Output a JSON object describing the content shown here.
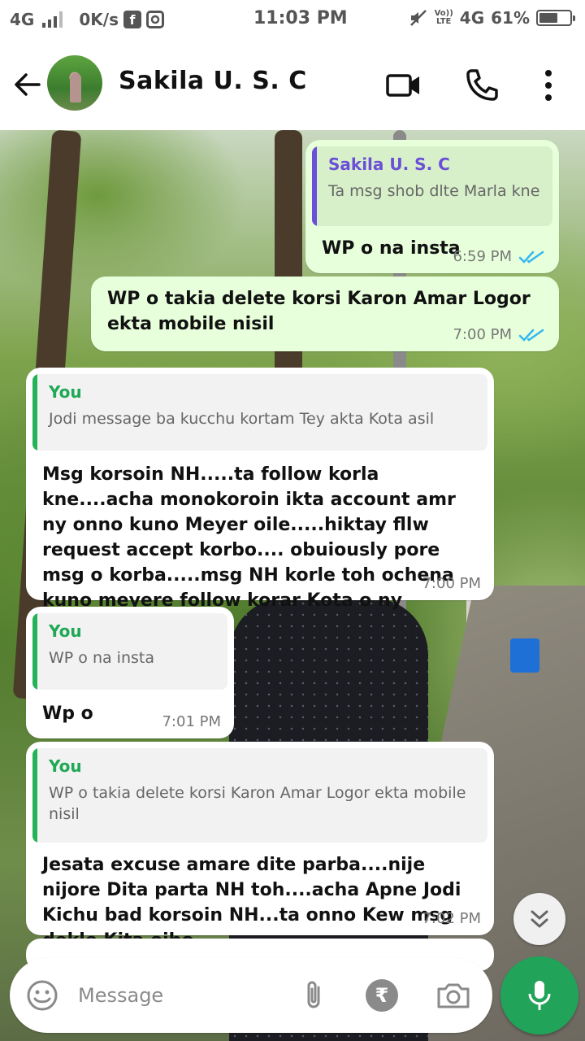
{
  "status_bar": {
    "network": "4G",
    "speed": "0K/s",
    "time": "11:03 PM",
    "volte_top": "Vo))",
    "volte_bottom": "LTE",
    "network2": "4G",
    "battery": "61%",
    "battery_level": 0.61
  },
  "header": {
    "contact_name": "Sakila U. S. C",
    "icons": [
      "back-arrow-icon",
      "video-call-icon",
      "phone-icon",
      "more-vert-icon"
    ]
  },
  "messages": [
    {
      "direction": "out",
      "quote_author": "Sakila U. S. C",
      "quote_text": "Ta msg shob dlte Marla kne",
      "text": "WP o na insta",
      "time": "6:59 PM",
      "status": "read"
    },
    {
      "direction": "out",
      "text": "WP o takia delete korsi Karon Amar Logor ekta mobile nisil",
      "time": "7:00 PM",
      "status": "read"
    },
    {
      "direction": "in",
      "quote_author": "You",
      "quote_text": "Jodi message ba kucchu kortam Tey akta Kota asil",
      "text": "Msg korsoin NH.....ta follow korla kne....acha monokoroin ikta account amr ny onno kuno Meyer oile.....hiktay fllw request accept korbo.... obuiously pore msg o korba.....msg NH korle toh ochena kuno meyere follow korar Kota o ny",
      "time": "7:00 PM"
    },
    {
      "direction": "in",
      "quote_author": "You",
      "quote_text": "WP o na insta",
      "text": "Wp o",
      "time": "7:01 PM"
    },
    {
      "direction": "in",
      "quote_author": "You",
      "quote_text": "WP o takia delete korsi Karon Amar Logor ekta mobile nisil",
      "text": "Jesata excuse amare dite parba....nije nijore Dita parta NH toh....acha Apne Jodi Kichu bad korsoin NH...ta onno Kew msg dekle Kita oibo",
      "time": "7:02 PM"
    }
  ],
  "input": {
    "placeholder": "Message",
    "currency_symbol": "₹"
  },
  "colors": {
    "outgoing_bubble": "#e7ffdb",
    "incoming_bubble": "#ffffff",
    "accent_green": "#22a35a",
    "read_ticks": "#34b7f1",
    "quote_bar_out": "#6b4fd8",
    "quote_bar_in": "#25b35a"
  }
}
